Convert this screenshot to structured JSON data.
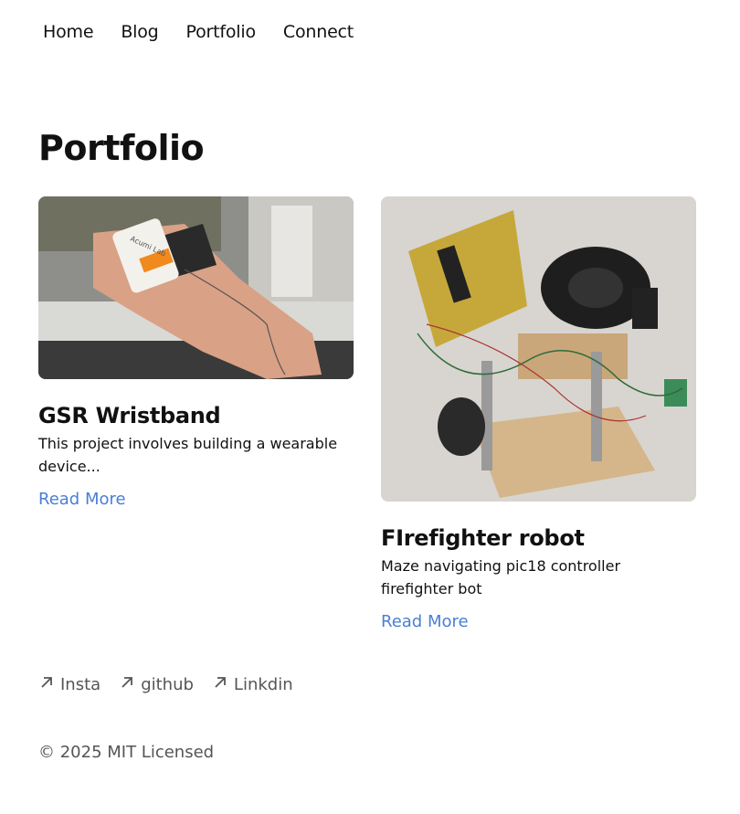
{
  "nav": {
    "items": [
      "Home",
      "Blog",
      "Portfolio",
      "Connect"
    ]
  },
  "page": {
    "title": "Portfolio"
  },
  "cards": [
    {
      "title": "GSR Wristband",
      "description": "This project involves building a wearable device...",
      "link": "Read More",
      "image_label": "Acumi Lab"
    },
    {
      "title": "FIrefighter robot",
      "description": "Maze navigating pic18 controller firefighter bot",
      "link": "Read More"
    }
  ],
  "social": {
    "items": [
      "Insta",
      "github",
      "Linkdin"
    ],
    "icon": "arrow-up-right-icon"
  },
  "footer": {
    "text": "© 2025 MIT Licensed"
  },
  "colors": {
    "link": "#4a7fd4",
    "muted": "#555555",
    "text": "#111111"
  }
}
